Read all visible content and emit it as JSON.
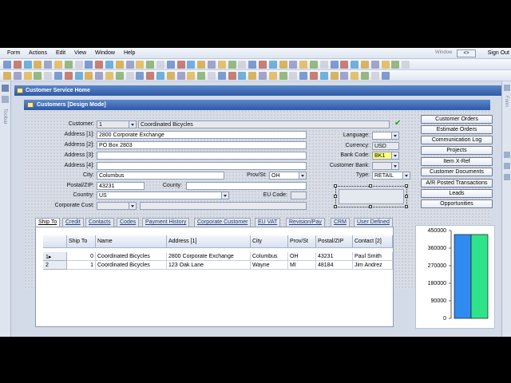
{
  "menu": {
    "items": [
      "Form",
      "Actions",
      "Edit",
      "View",
      "Window",
      "Help"
    ],
    "window_badge": "Window",
    "mini": "<>",
    "sign_out": "Sign Out"
  },
  "side": {
    "left_label": "Toolbar",
    "right_label": "Form"
  },
  "windows": {
    "home_title": "Customer Service Home",
    "form_title": "Customers  [Design Mode]"
  },
  "form": {
    "customer_label": "Customer:",
    "customer_num": "1",
    "customer_name": "Coordinated Bicycles",
    "addr1_label": "Address [1]:",
    "addr1": "2800 Corporate Exchange",
    "addr2_label": "Address [2]:",
    "addr2": "PO Box 2803",
    "addr3_label": "Address [3]:",
    "addr3": "",
    "addr4_label": "Address [4]:",
    "addr4": "",
    "city_label": "City:",
    "city": "Columbus",
    "prov_label": "Prov/St:",
    "prov": "OH",
    "postal_label": "Postal/ZIP:",
    "postal": "43231",
    "county_label": "County:",
    "county": "",
    "country_label": "Country:",
    "country": "US",
    "eu_label": "EU Code:",
    "eu": "",
    "corp_label": "Corporate Cust:",
    "corp": "",
    "language_label": "Language:",
    "language": "",
    "currency_label": "Currency:",
    "currency": "USD",
    "bank_label": "Bank Code:",
    "bank": "BK1",
    "custbank_label": "Customer Bank:",
    "custbank": "",
    "type_label": "Type:",
    "type": "RETAIL"
  },
  "buttons": [
    "Customer Orders",
    "Estimate Orders",
    "Communication Log",
    "Projects",
    "Item X-Ref",
    "Customer Documents",
    "A/R Posted Transactions",
    "Leads",
    "Opportunities"
  ],
  "tabs": [
    "Ship To",
    "Credit",
    "Contacts",
    "Codes",
    "Payment History",
    "Corporate Customer",
    "EU VAT",
    "Revision/Pay",
    "CRM",
    "User Defined"
  ],
  "grid": {
    "headers": [
      "Ship To",
      "Name",
      "Address [1]",
      "City",
      "Prov/St",
      "Postal/ZIP",
      "Contact [2]"
    ],
    "rows": [
      {
        "marker": "1▸",
        "cells": [
          "0",
          "Coordinated Bicycles",
          "2800 Corporate Exchange",
          "Columbus",
          "OH",
          "43231",
          "Paul Smith"
        ]
      },
      {
        "marker": "2",
        "cells": [
          "1",
          "Coordinated Bicycles",
          "123 Oak Lane",
          "Wayne",
          "MI",
          "48184",
          "Jim Andrez"
        ]
      }
    ]
  },
  "chart_data": {
    "type": "bar",
    "categories": [
      "",
      ""
    ],
    "series": [
      {
        "values": [
          430000
        ]
      },
      {
        "values": [
          430000
        ]
      }
    ],
    "ylim": [
      0,
      450000
    ],
    "yticks": [
      "450000",
      "360000",
      "270000",
      "180000",
      "90000",
      "0"
    ],
    "colors": [
      "#2f8bef",
      "#2ee38a"
    ]
  },
  "colors": {
    "titlebar": "#2e5aa8",
    "accent_green": "#2ee38a",
    "accent_blue": "#2f8bef",
    "highlight": "#ffff80"
  }
}
